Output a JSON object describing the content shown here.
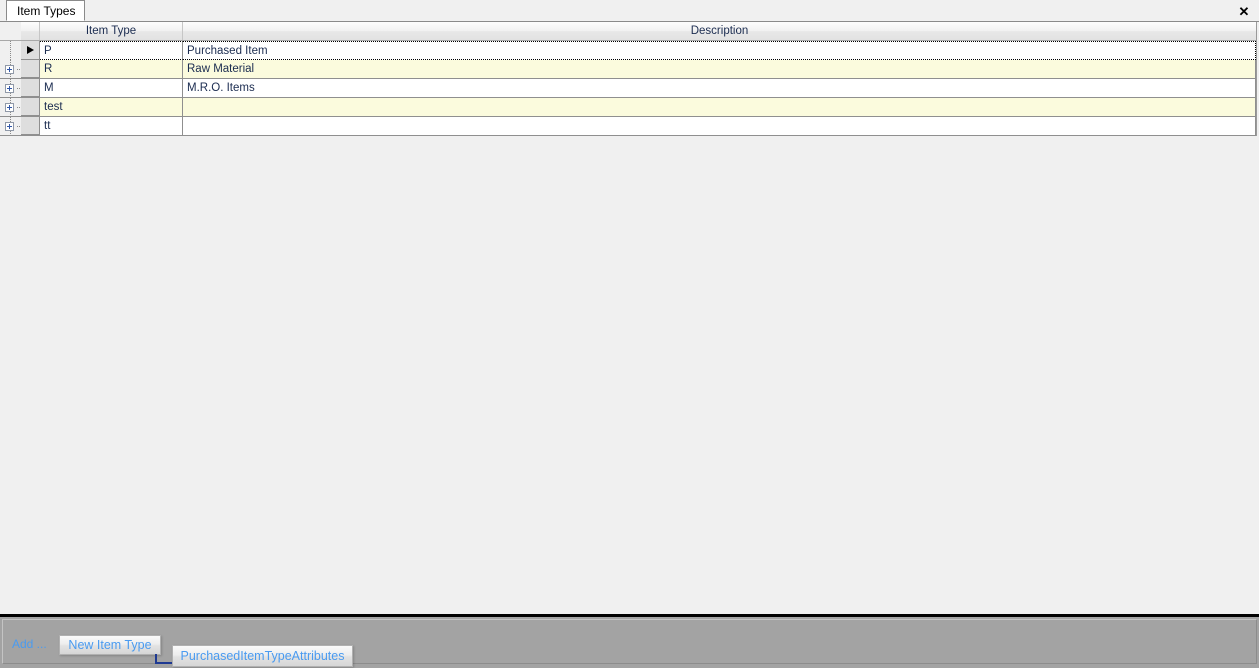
{
  "window": {
    "title": "Item Types",
    "close_label": "✕",
    "close_icon": "close-icon",
    "background_color": "#f0f0f0"
  },
  "tabs": [
    {
      "label": "Item Types",
      "active": true
    }
  ],
  "grid": {
    "columns": [
      {
        "key": "item_type",
        "label": "Item Type"
      },
      {
        "key": "description",
        "label": "Description"
      }
    ],
    "row_header_icon": "row-selector-arrow-icon",
    "expander_icon": "plus-box-icon",
    "alt_row_color": "#fbfbdd",
    "row_color": "#ffffff",
    "header_text_color": "#1b2c50",
    "rows": [
      {
        "item_type": "P",
        "description": "Purchased Item",
        "current": true,
        "expandable": false,
        "alt": false
      },
      {
        "item_type": "R",
        "description": "Raw Material",
        "current": false,
        "expandable": true,
        "alt": true
      },
      {
        "item_type": "M",
        "description": "M.R.O. Items",
        "current": false,
        "expandable": true,
        "alt": false
      },
      {
        "item_type": "test",
        "description": "",
        "current": false,
        "expandable": true,
        "alt": true
      },
      {
        "item_type": "tt",
        "description": "",
        "current": false,
        "expandable": true,
        "alt": false
      }
    ]
  },
  "designer": {
    "add_label": "Add ...",
    "background_color": "#a3a3a3",
    "link_color": "#4a9bf0",
    "connector_color": "#1f3a93",
    "buttons": [
      {
        "label": "New Item Type",
        "name": "new-item-type-button"
      },
      {
        "label": "PurchasedItemTypeAttributes",
        "name": "purchased-item-type-attributes-button"
      }
    ]
  }
}
